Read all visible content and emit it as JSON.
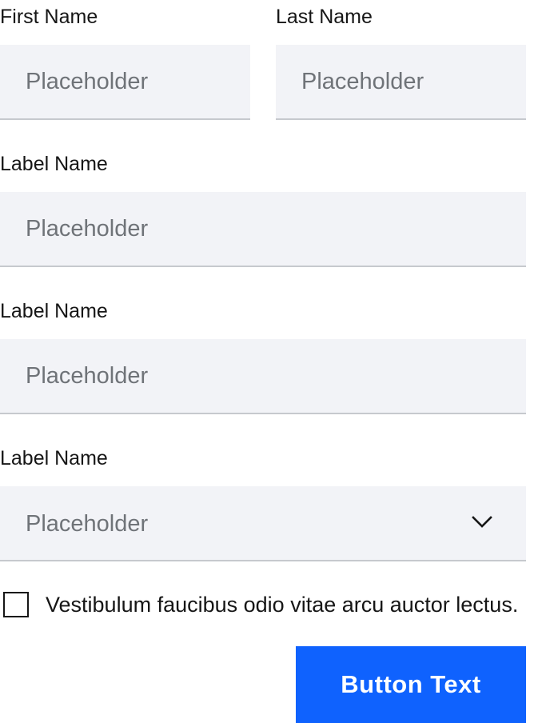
{
  "form": {
    "first_name": {
      "label": "First Name",
      "placeholder": "Placeholder"
    },
    "last_name": {
      "label": "Last Name",
      "placeholder": "Placeholder"
    },
    "field_1": {
      "label": "Label Name",
      "placeholder": "Placeholder"
    },
    "field_2": {
      "label": "Label Name",
      "placeholder": "Placeholder"
    },
    "select": {
      "label": "Label Name",
      "selected": "Placeholder",
      "icon": "chevron-down-icon"
    },
    "checkbox": {
      "label": "Vestibulum faucibus odio vitae arcu auctor lectus.",
      "checked": false
    },
    "submit_label": "Button Text"
  },
  "colors": {
    "field_background": "#f2f3f7",
    "field_border": "#c6c9ce",
    "placeholder_text": "#6f7378",
    "primary_button": "#0f62fe",
    "text": "#161616"
  }
}
